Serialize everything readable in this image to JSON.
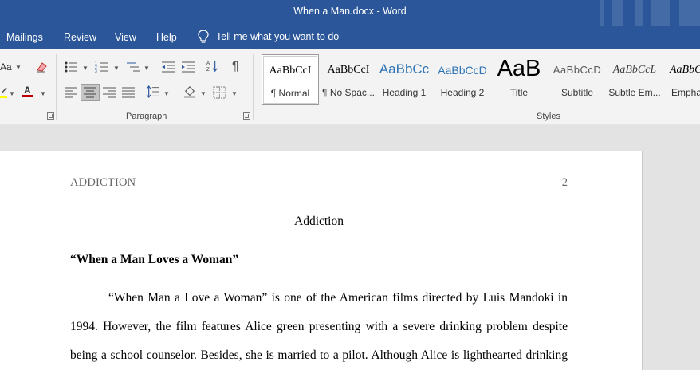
{
  "window": {
    "title": "When a Man.docx  -  Word"
  },
  "menu": {
    "tabs": [
      "Mailings",
      "Review",
      "View",
      "Help"
    ],
    "tell_me": "Tell me what you want to do"
  },
  "ribbon": {
    "font_size_label": "Aa",
    "paragraph_label": "Paragraph",
    "styles_label": "Styles",
    "styles": [
      {
        "sample": "AaBbCcI",
        "name": "¶ Normal"
      },
      {
        "sample": "AaBbCcI",
        "name": "¶ No Spac..."
      },
      {
        "sample": "AaBbCc",
        "name": "Heading 1"
      },
      {
        "sample": "AaBbCcD",
        "name": "Heading 2"
      },
      {
        "sample": "AaB",
        "name": "Title"
      },
      {
        "sample": "AaBbCcD",
        "name": "Subtitle"
      },
      {
        "sample": "AaBbCcL",
        "name": "Subtle Em..."
      },
      {
        "sample": "AaBbC",
        "name": "Empha"
      }
    ],
    "colors": {
      "font_color": "#c00000",
      "highlight": "#ffff00",
      "accent": "#2b579a"
    }
  },
  "document": {
    "header_left": "ADDICTION",
    "page_number": "2",
    "title": "Addiction",
    "heading": "“When a Man Loves a Woman”",
    "lines": [
      "“When Man a Love a Woman” is one of the American films directed by Luis Mandoki in",
      "1994. However, the film features Alice green presenting with a severe drinking problem despite",
      "being a school counselor. Besides, she is married to a pilot. Although Alice is lighthearted drinking"
    ]
  }
}
